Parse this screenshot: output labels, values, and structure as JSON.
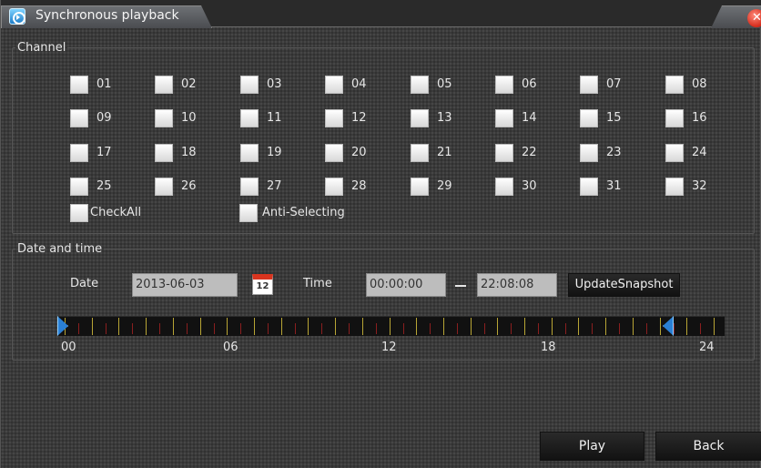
{
  "window": {
    "title": "Synchronous playback"
  },
  "channel_group": {
    "legend": "Channel",
    "channels": [
      "01",
      "02",
      "03",
      "04",
      "05",
      "06",
      "07",
      "08",
      "09",
      "10",
      "11",
      "12",
      "13",
      "14",
      "15",
      "16",
      "17",
      "18",
      "19",
      "20",
      "21",
      "22",
      "23",
      "24",
      "25",
      "26",
      "27",
      "28",
      "29",
      "30",
      "31",
      "32"
    ],
    "check_all": "CheckAll",
    "anti_selecting": "Anti-Selecting"
  },
  "datetime_group": {
    "legend": "Date and time",
    "date_label": "Date",
    "date_value": "2013-06-03",
    "calendar_day": "12",
    "time_label": "Time",
    "start_time": "00:00:00",
    "end_time": "22:08:08",
    "update_snapshot": "UpdateSnapshot"
  },
  "timeline": {
    "hour_labels": [
      "00",
      "06",
      "12",
      "18",
      "24"
    ],
    "range_start_hour": 0,
    "range_end_hour": 22.14
  },
  "buttons": {
    "play": "Play",
    "back": "Back"
  },
  "colors": {
    "close": "#d42a1a",
    "handle": "#2a7fd4",
    "major_tick": "#b8a535",
    "minor_tick": "#8a1f1f"
  }
}
